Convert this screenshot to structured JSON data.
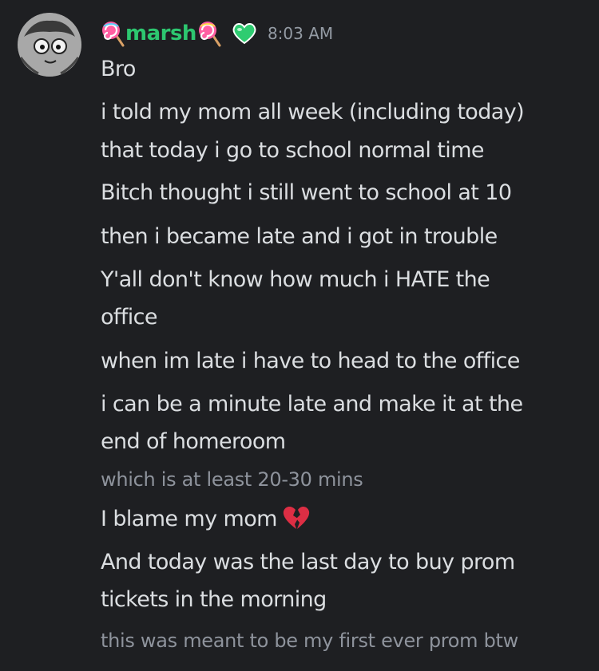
{
  "author": {
    "name": "marsh",
    "timestamp": "8:03 AM",
    "avatar_icon": "avatar-icon",
    "name_color": "#2dc770"
  },
  "messages": [
    {
      "text": "Bro",
      "dim": false
    },
    {
      "text": "i told my mom all week (including today)",
      "dim": false
    },
    {
      "text": "that today i go to school normal time",
      "dim": false
    },
    {
      "text": "Bitch thought i still went to school at 10",
      "dim": false
    },
    {
      "text": "then i became late and i got in trouble",
      "dim": false
    },
    {
      "line1": "Y'all don't know how much i HATE the",
      "line2": "office",
      "dim": false
    },
    {
      "text": "when im late i have to head to the office",
      "dim": false
    },
    {
      "line1": "i can be a minute late and make it at the",
      "line2": "end of homeroom",
      "dim": false
    },
    {
      "text": "which is at least 20-30 mins",
      "dim": true
    },
    {
      "text": "I blame my mom",
      "emoji": "broken-heart-icon",
      "dim": false
    },
    {
      "line1": "And today was the last day to buy prom",
      "line2": "tickets in the morning",
      "dim": false
    },
    {
      "text": "this was meant to be my first ever prom btw",
      "dim": true
    }
  ]
}
